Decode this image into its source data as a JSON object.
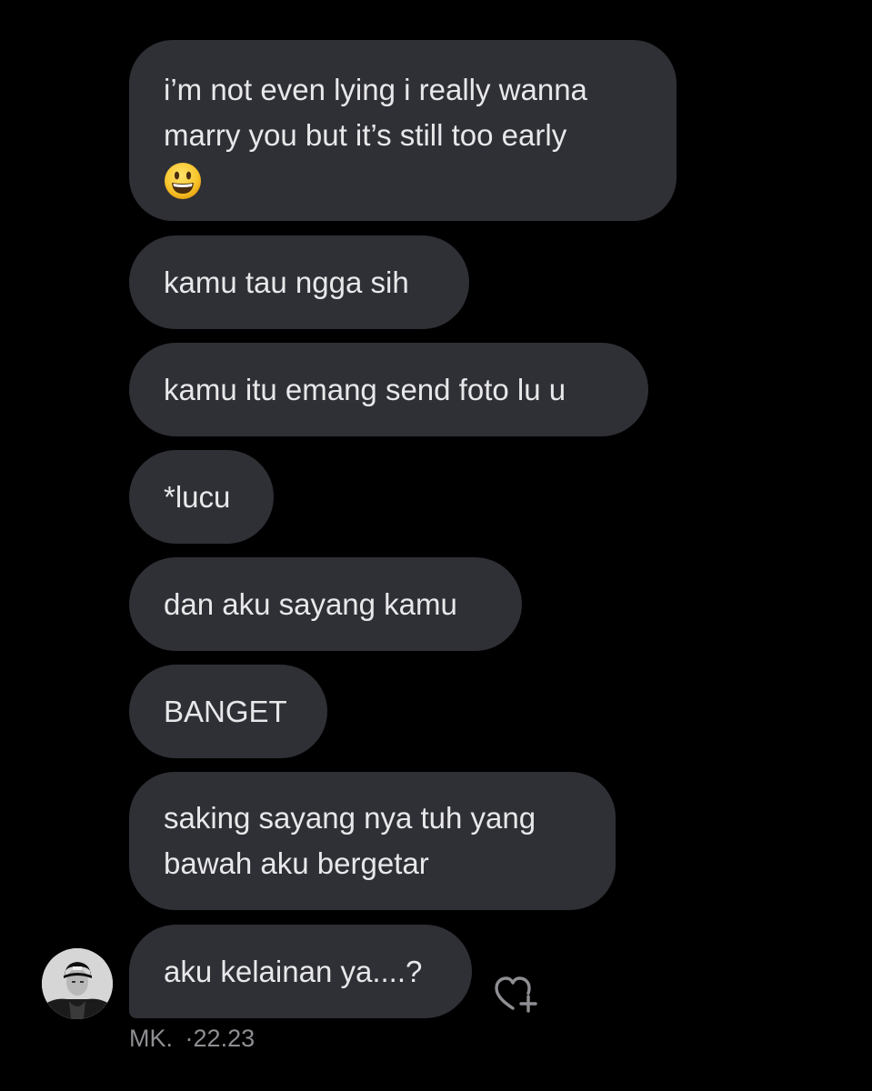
{
  "messages": [
    {
      "lines": [
        "i’m not even lying i really wanna",
        "marry you but it’s still too early"
      ],
      "emoji": "grinning-face"
    },
    {
      "text": "kamu tau ngga sih"
    },
    {
      "text": "kamu itu emang send foto lu u"
    },
    {
      "text": "*lucu"
    },
    {
      "text": "dan aku sayang kamu"
    },
    {
      "text": "BANGET"
    },
    {
      "lines": [
        "saking sayang nya tuh yang",
        "bawah aku bergetar"
      ]
    },
    {
      "text": "aku kelainan ya....?"
    }
  ],
  "sender": {
    "name": "MK.",
    "separator": "·",
    "time": "22.23"
  },
  "icons": {
    "react": "heart-plus-icon",
    "emoji": "grinning-face-icon"
  },
  "colors": {
    "background": "#000000",
    "bubble": "#2f3036",
    "text": "#e8e8ea",
    "meta": "#8e8e93"
  }
}
